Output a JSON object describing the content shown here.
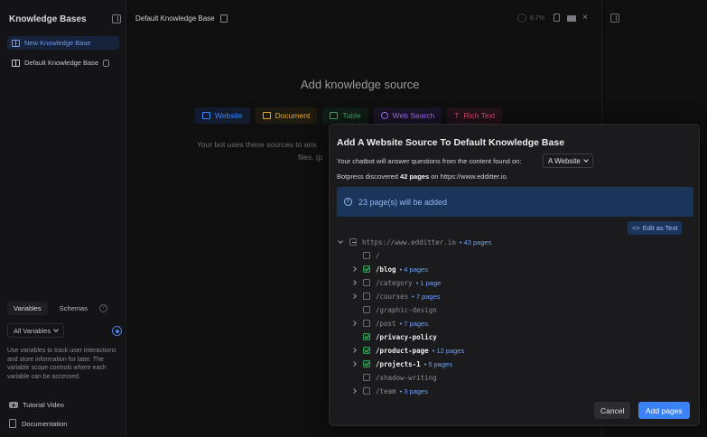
{
  "sidebar": {
    "title": "Knowledge Bases",
    "items": [
      {
        "label": "New Knowledge Base"
      },
      {
        "label": "Default Knowledge Base"
      }
    ],
    "tabs": [
      "Variables",
      "Schemas"
    ],
    "variables_filter": "All Variables",
    "variables_description": "Use variables to track user interactions and store information for later. The variable scope controls where each variable can be accessed.",
    "links": {
      "tutorial": "Tutorial Video",
      "docs": "Documentation"
    }
  },
  "header": {
    "title": "Default Knowledge Base",
    "usage": "8.7%"
  },
  "main": {
    "heading": "Add knowledge source",
    "source_tabs": [
      {
        "label": "Website",
        "color": "#3b82f6"
      },
      {
        "label": "Document",
        "color": "#f0b429"
      },
      {
        "label": "Table",
        "color": "#3fa56a"
      },
      {
        "label": "Web Search",
        "color": "#a970ff"
      },
      {
        "label": "Rich Text",
        "color": "#e05174"
      }
    ],
    "description": "Your bot uses these sources to ans",
    "description2": "files. (p"
  },
  "modal": {
    "title": "Add A Website Source To Default Knowledge Base",
    "question": "Your chatbot will answer questions from the content found on:",
    "source_type": "A Website",
    "discovered_prefix": "Botpress discovered",
    "discovered_count": "42 pages",
    "discovered_suffix": "on https://www.edditter.io.",
    "banner": "23 page(s) will be added",
    "edit_button": "Edit as Text",
    "tree": [
      {
        "label": "https://www.edditter.io",
        "count": "• 43 pages",
        "checked": "partial",
        "expandable": "down",
        "level": 0
      },
      {
        "label": "/",
        "count": "",
        "checked": "off",
        "expandable": "none",
        "level": 1
      },
      {
        "label": "/blog",
        "count": "• 4 pages",
        "checked": "on",
        "expandable": "right",
        "level": 1
      },
      {
        "label": "/category",
        "count": "• 1 page",
        "checked": "off",
        "expandable": "right",
        "level": 1
      },
      {
        "label": "/courses",
        "count": "• 7 pages",
        "checked": "off",
        "expandable": "right",
        "level": 1
      },
      {
        "label": "/graphic-design",
        "count": "",
        "checked": "off",
        "expandable": "none",
        "level": 1
      },
      {
        "label": "/post",
        "count": "• 7 pages",
        "checked": "off",
        "expandable": "right",
        "level": 1
      },
      {
        "label": "/privacy-policy",
        "count": "",
        "checked": "on",
        "expandable": "none",
        "level": 1
      },
      {
        "label": "/product-page",
        "count": "• 12 pages",
        "checked": "on",
        "expandable": "right",
        "level": 1
      },
      {
        "label": "/projects-1",
        "count": "• 5 pages",
        "checked": "on",
        "expandable": "right",
        "level": 1
      },
      {
        "label": "/shadow-writing",
        "count": "",
        "checked": "off",
        "expandable": "none",
        "level": 1
      },
      {
        "label": "/team",
        "count": "• 3 pages",
        "checked": "off",
        "expandable": "right",
        "level": 1
      }
    ],
    "cancel": "Cancel",
    "submit": "Add pages"
  }
}
